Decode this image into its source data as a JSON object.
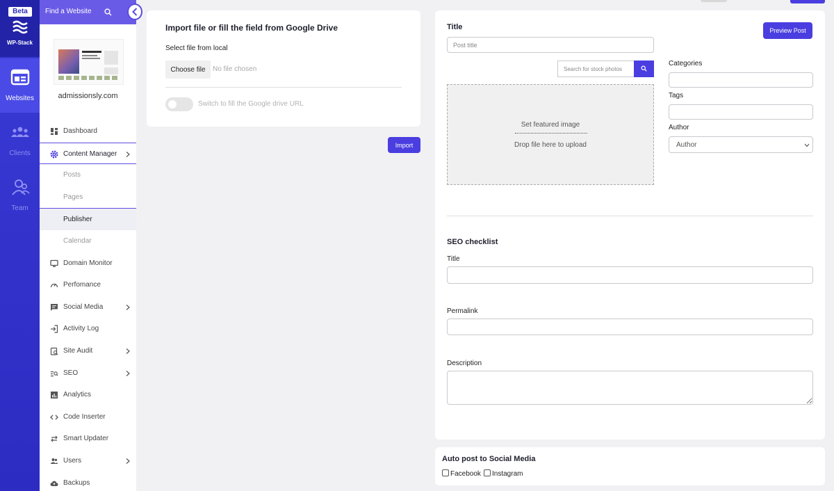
{
  "brand": {
    "badge": "Beta",
    "name": "WP-Stack",
    "accent": "#4a3ee0"
  },
  "rail": [
    {
      "label": "Websites",
      "icon": "websites-icon",
      "active": true
    },
    {
      "label": "Clients",
      "icon": "clients-icon"
    },
    {
      "label": "Team",
      "icon": "team-icon"
    }
  ],
  "sidebar": {
    "search_placeholder": "Find a Website",
    "site_name": "admissionsly.com",
    "items": [
      {
        "label": "Dashboard",
        "icon": "dashboard-icon"
      },
      {
        "label": "Content Manager",
        "icon": "gear-icon"
      },
      {
        "label": "Posts"
      },
      {
        "label": "Pages"
      },
      {
        "label": "Publisher"
      },
      {
        "label": "Calendar"
      },
      {
        "label": "Domain Monitor",
        "icon": "monitor-icon"
      },
      {
        "label": "Perfomance",
        "icon": "gauge-icon"
      },
      {
        "label": "Social Media",
        "icon": "chat-icon"
      },
      {
        "label": "Activity Log",
        "icon": "login-icon"
      },
      {
        "label": "Site Audit",
        "icon": "audit-icon"
      },
      {
        "label": "SEO",
        "icon": "seo-icon"
      },
      {
        "label": "Analytics",
        "icon": "analytics-icon"
      },
      {
        "label": "Code Inserter",
        "icon": "code-icon"
      },
      {
        "label": "Smart Updater",
        "icon": "sync-icon"
      },
      {
        "label": "Users",
        "icon": "users-icon"
      },
      {
        "label": "Backups",
        "icon": "cloud-icon"
      }
    ]
  },
  "import": {
    "heading": "Import file or fill the field from Google Drive",
    "local_label": "Select file from local",
    "choose_label": "Choose file",
    "no_file": "No file chosen",
    "toggle_label": "Switch to fill the Google drive URL",
    "import_button": "Import"
  },
  "post": {
    "title_label": "Title",
    "title_placeholder": "Post title",
    "preview_button": "Preview Post",
    "stock_placeholder": "Search for stock photos",
    "featured": "Set featured image",
    "drop": "Drop file here to upload",
    "categories_label": "Categories",
    "tags_label": "Tags",
    "author_label": "Author",
    "author_selected": "Author"
  },
  "seo": {
    "heading": "SEO checklist",
    "title_label": "Title",
    "permalink_label": "Permalink",
    "description_label": "Description"
  },
  "social": {
    "heading": "Auto post to Social Media",
    "facebook": "Facebook",
    "instagram": "Instagram"
  }
}
